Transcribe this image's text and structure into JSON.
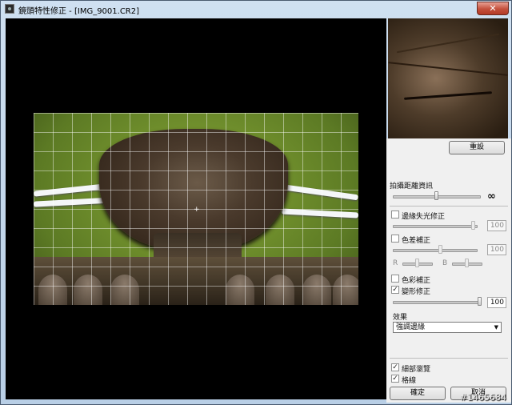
{
  "window": {
    "title": "鏡頭特性修正 - [IMG_9001.CR2]",
    "close_glyph": "✕"
  },
  "preview": {
    "crosshair": "+"
  },
  "panel": {
    "reset_label": "重設",
    "shooting_distance_label": "拍攝距離資訊",
    "infinity_glyph": "∞",
    "peripheral_label": "邊緣失光修正",
    "peripheral_value": "100",
    "peripheral_checked": "",
    "chromatic_label": "色差補正",
    "chromatic_value": "100",
    "chromatic_checked": "",
    "r_label": "R",
    "b_label": "B",
    "color_blur_label": "色彩補正",
    "color_blur_checked": "",
    "distortion_label": "變形修正",
    "distortion_checked": "✓",
    "distortion_value": "100",
    "effect_label": "效果",
    "effect_selected": "強調邊緣",
    "effect_arrow": "▼",
    "detail_view_label": "細部瀏覽",
    "detail_view_checked": "✓",
    "grid_label": "格線",
    "grid_checked": "✓",
    "ok_label": "確定",
    "cancel_label": "取消"
  },
  "watermark": "#1465684",
  "sliders": {
    "shooting_distance": 0.5,
    "peripheral": 0.96,
    "chromatic": 0.57,
    "r": 0.5,
    "b": 0.5,
    "distortion": 1.0
  }
}
